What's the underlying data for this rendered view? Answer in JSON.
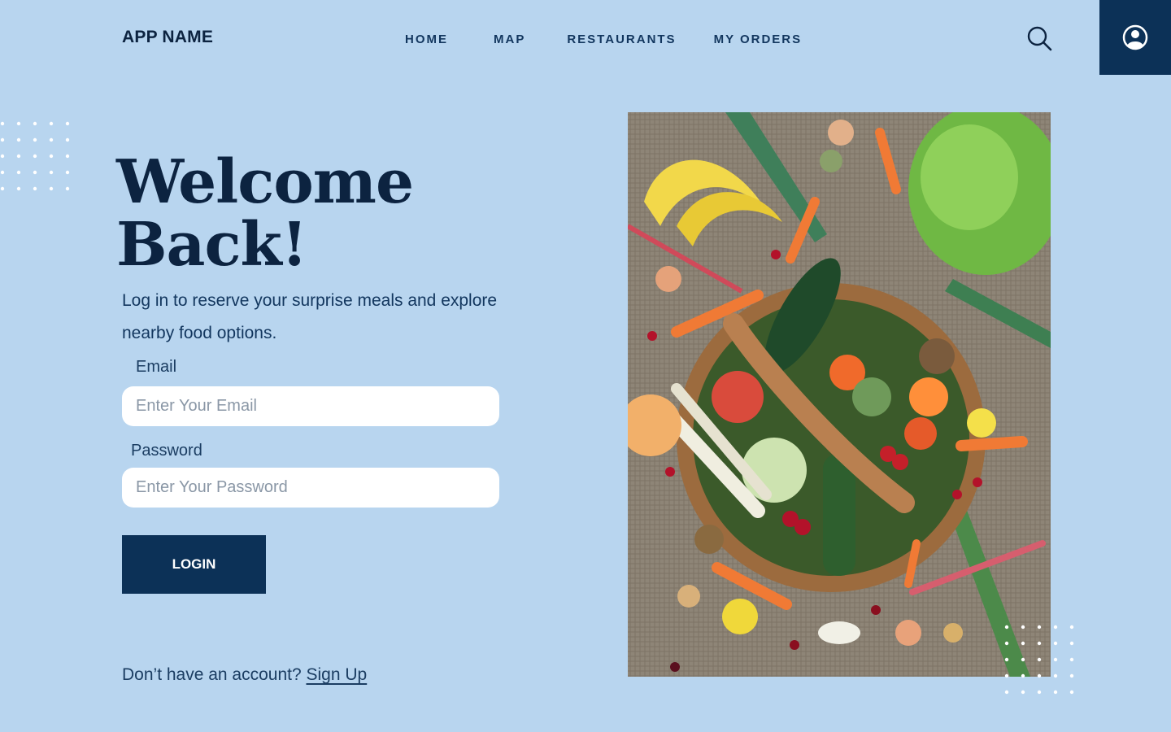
{
  "header": {
    "app_name": "APP NAME",
    "nav": [
      "HOME",
      "MAP",
      "RESTAURANTS",
      "MY ORDERS"
    ],
    "search_icon": "search-icon",
    "profile_icon": "user-circle-icon"
  },
  "hero": {
    "title_line1": "Welcome",
    "title_line2": "Back!",
    "subtitle": "Log in to reserve your surprise meals and explore nearby food options."
  },
  "form": {
    "email_label": "Email",
    "email_placeholder": "Enter Your Email",
    "email_value": "",
    "password_label": "Password",
    "password_placeholder": "Enter Your Password",
    "password_value": "",
    "login_label": "LOGIN"
  },
  "footer": {
    "prompt": "Don’t have an account?",
    "signup_label": "Sign Up"
  },
  "colors": {
    "background": "#b8d5ef",
    "primary": "#0c3157",
    "text": "#0c2340",
    "field": "#ffffff"
  }
}
